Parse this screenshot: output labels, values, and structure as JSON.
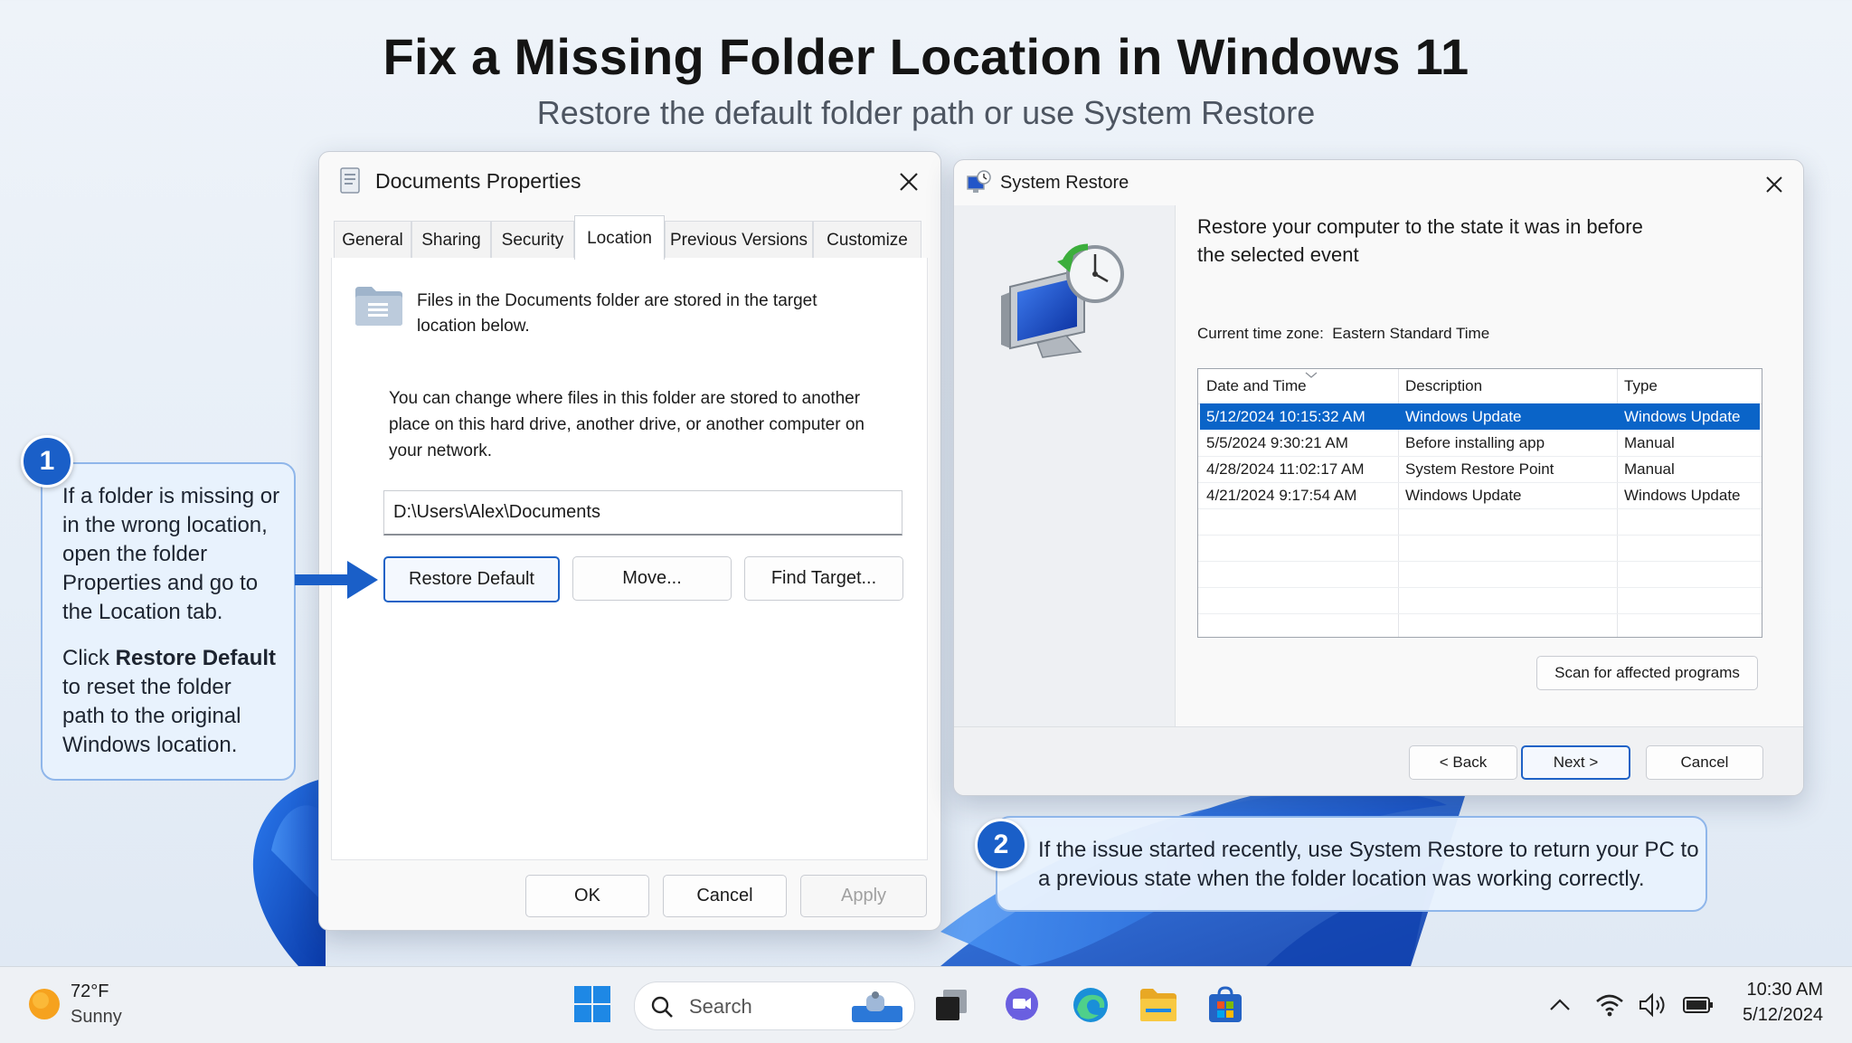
{
  "header": {
    "title": "Fix a Missing Folder Location in Windows 11",
    "subtitle": "Restore the default folder path or use System Restore"
  },
  "props_window": {
    "title": "Documents Properties",
    "tabs": [
      "General",
      "Sharing",
      "Security",
      "Location",
      "Previous Versions",
      "Customize"
    ],
    "active_tab": "Location",
    "intro_line1": "Files in the Documents folder are stored in the target",
    "intro_line2": "location below.",
    "desc_line1": "You can change where files in this folder are stored to another",
    "desc_line2": "place on this hard drive, another drive, or another computer on",
    "desc_line3": "your network.",
    "path_value": "D:\\Users\\Alex\\Documents",
    "restore_default": "Restore Default",
    "move": "Move...",
    "find_target": "Find Target...",
    "ok": "OK",
    "cancel": "Cancel",
    "apply": "Apply"
  },
  "restore_window": {
    "title": "System Restore",
    "heading_line1": "Restore your computer to the state it was in before",
    "heading_line2": "the selected event",
    "timezone_label": "Current time zone:",
    "timezone_value": "Eastern Standard Time",
    "columns": [
      "Date and Time",
      "Description",
      "Type"
    ],
    "rows": [
      {
        "date": "5/12/2024 10:15:32 AM",
        "description": "Windows Update",
        "type": "Windows Update"
      },
      {
        "date": "5/5/2024 9:30:21 AM",
        "description": "Before installing app",
        "type": "Manual"
      },
      {
        "date": "4/28/2024 11:02:17 AM",
        "description": "System Restore Point",
        "type": "Manual"
      },
      {
        "date": "4/21/2024 9:17:54 AM",
        "description": "Windows Update",
        "type": "Windows Update"
      }
    ],
    "scan_button": "Scan for affected programs",
    "back": "< Back",
    "next": "Next >",
    "cancel": "Cancel"
  },
  "callout1": {
    "number": "1",
    "lines": [
      "If a folder is missing or",
      "in the wrong location,",
      "open the folder",
      "Properties and go to",
      "the Location tab."
    ],
    "click_prefix": "Click ",
    "click_bold": "Restore Default",
    "lines2": [
      "to reset the folder",
      "path to the original",
      "Windows location."
    ]
  },
  "callout2": {
    "number": "2",
    "line1": "If the issue started recently, use System Restore to return your PC to",
    "line2": "a previous state when the folder location was working correctly."
  },
  "taskbar": {
    "weather_temp": "72°F",
    "weather_desc": "Sunny",
    "search_placeholder": "Search",
    "time": "10:30 AM",
    "date": "5/12/2024"
  },
  "colors": {
    "accent": "#1a5fc8",
    "selection": "#0a64c8",
    "callout_bg": "#e8f1fd"
  }
}
